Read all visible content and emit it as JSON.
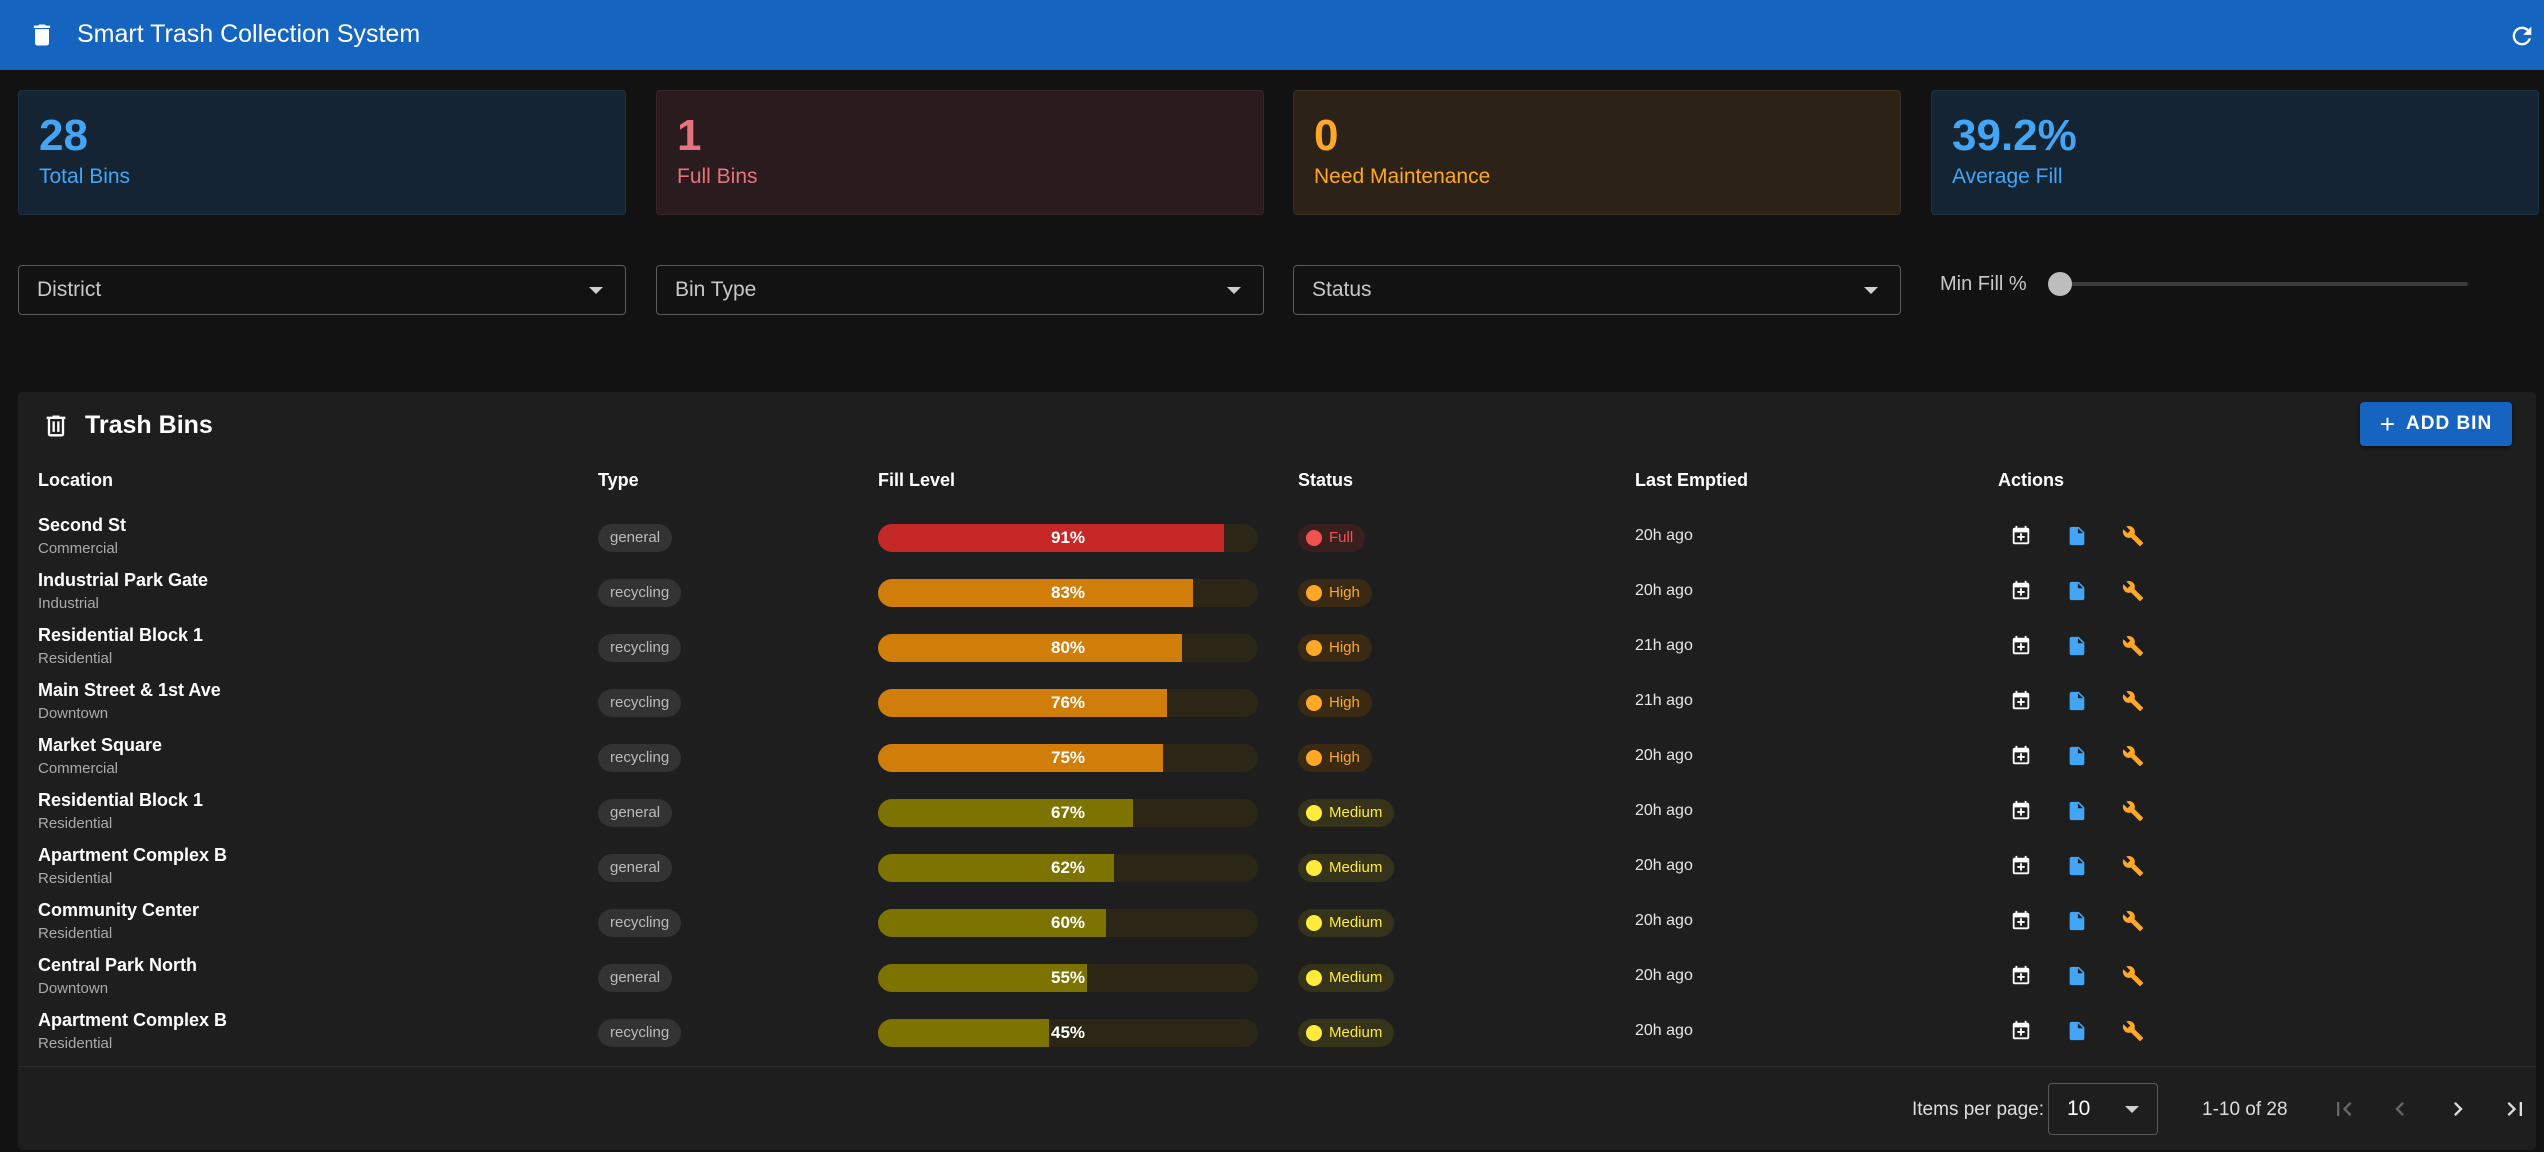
{
  "appbar": {
    "title": "Smart Trash Collection System",
    "logo_icon": "trash-icon",
    "refresh_icon": "refresh-icon"
  },
  "stats": [
    {
      "value": "28",
      "label": "Total Bins",
      "color": "#42a5f5"
    },
    {
      "value": "1",
      "label": "Full Bins",
      "color": "#e5737e"
    },
    {
      "value": "0",
      "label": "Need Maintenance",
      "color": "#ffa726"
    },
    {
      "value": "39.2%",
      "label": "Average Fill",
      "color": "#42a5f5"
    }
  ],
  "filters": {
    "district": "District",
    "bin_type": "Bin Type",
    "status": "Status",
    "min_fill_label": "Min Fill %",
    "min_fill_value": 0
  },
  "table": {
    "title": "Trash Bins",
    "add_button": "ADD BIN",
    "headers": [
      "Location",
      "Type",
      "Fill Level",
      "Status",
      "Last Emptied",
      "Actions"
    ],
    "rows": [
      {
        "location": "Second St",
        "district": "Commercial",
        "type": "general",
        "fill": 91,
        "fill_label": "91%",
        "status": "Full",
        "last_emptied": "20h ago"
      },
      {
        "location": "Industrial Park Gate",
        "district": "Industrial",
        "type": "recycling",
        "fill": 83,
        "fill_label": "83%",
        "status": "High",
        "last_emptied": "20h ago"
      },
      {
        "location": "Residential Block 1",
        "district": "Residential",
        "type": "recycling",
        "fill": 80,
        "fill_label": "80%",
        "status": "High",
        "last_emptied": "21h ago"
      },
      {
        "location": "Main Street & 1st Ave",
        "district": "Downtown",
        "type": "recycling",
        "fill": 76,
        "fill_label": "76%",
        "status": "High",
        "last_emptied": "21h ago"
      },
      {
        "location": "Market Square",
        "district": "Commercial",
        "type": "recycling",
        "fill": 75,
        "fill_label": "75%",
        "status": "High",
        "last_emptied": "20h ago"
      },
      {
        "location": "Residential Block 1",
        "district": "Residential",
        "type": "general",
        "fill": 67,
        "fill_label": "67%",
        "status": "Medium",
        "last_emptied": "20h ago"
      },
      {
        "location": "Apartment Complex B",
        "district": "Residential",
        "type": "general",
        "fill": 62,
        "fill_label": "62%",
        "status": "Medium",
        "last_emptied": "20h ago"
      },
      {
        "location": "Community Center",
        "district": "Residential",
        "type": "recycling",
        "fill": 60,
        "fill_label": "60%",
        "status": "Medium",
        "last_emptied": "20h ago"
      },
      {
        "location": "Central Park North",
        "district": "Downtown",
        "type": "general",
        "fill": 55,
        "fill_label": "55%",
        "status": "Medium",
        "last_emptied": "20h ago"
      },
      {
        "location": "Apartment Complex B",
        "district": "Residential",
        "type": "recycling",
        "fill": 45,
        "fill_label": "45%",
        "status": "Medium",
        "last_emptied": "20h ago"
      }
    ],
    "action_icons": [
      "calendar-add-icon",
      "document-icon",
      "wrench-icon"
    ]
  },
  "pagination": {
    "items_per_page_label": "Items per page:",
    "items_per_page": "10",
    "range": "1-10 of 28"
  },
  "colors": {
    "appbar": "#1565c0",
    "full": "#c62828",
    "high": "#d17d0a",
    "medium": "#7d7300",
    "full_text": "#ef5350",
    "high_text": "#ffa726",
    "medium_text": "#ffeb3b"
  }
}
